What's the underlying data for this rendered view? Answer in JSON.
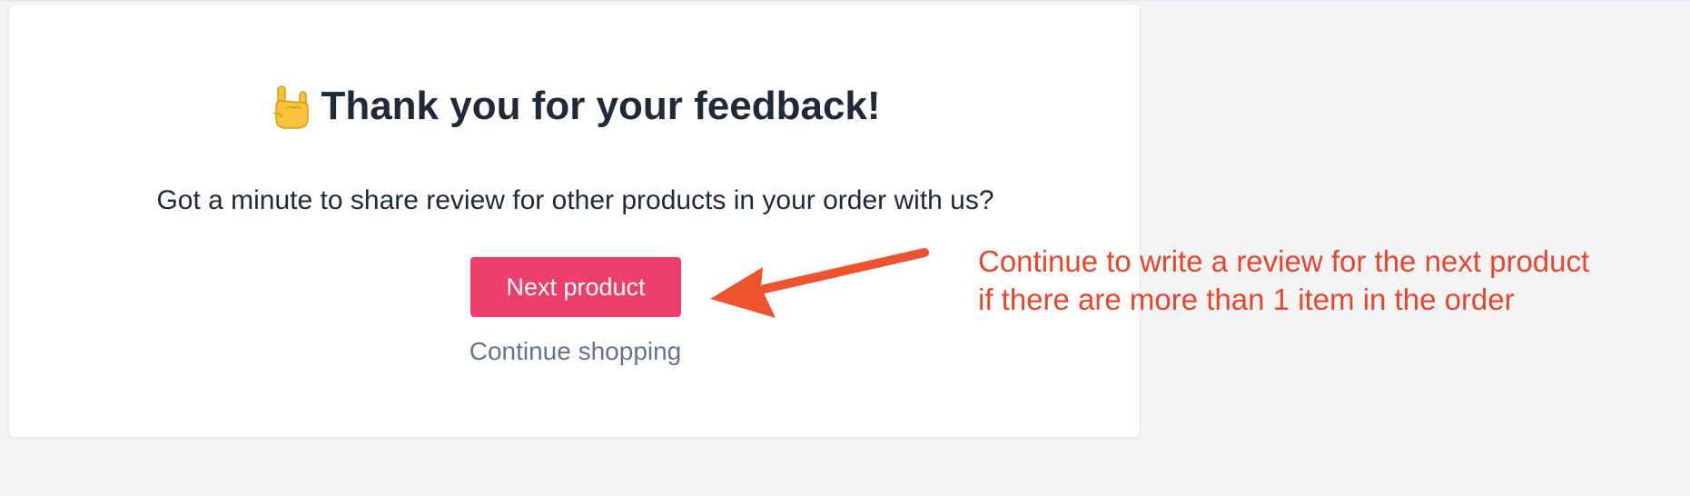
{
  "card": {
    "heading": "Thank you for your feedback!",
    "heading_icon": "rock-on-hand-icon",
    "subtitle": "Got a minute to share review for other products in your order with us?",
    "next_button_label": "Next product",
    "continue_link_label": "Continue shopping"
  },
  "annotation": {
    "line1": "Continue to write a review for the next product",
    "line2": "if there are more than 1 item in the order",
    "arrow_icon": "arrow-left-icon"
  },
  "colors": {
    "primary_button": "#ec3f6a",
    "annotation": "#e8452d",
    "heading_text": "#1f2937",
    "muted_link": "#64748b",
    "page_background": "#f3f4f6"
  }
}
